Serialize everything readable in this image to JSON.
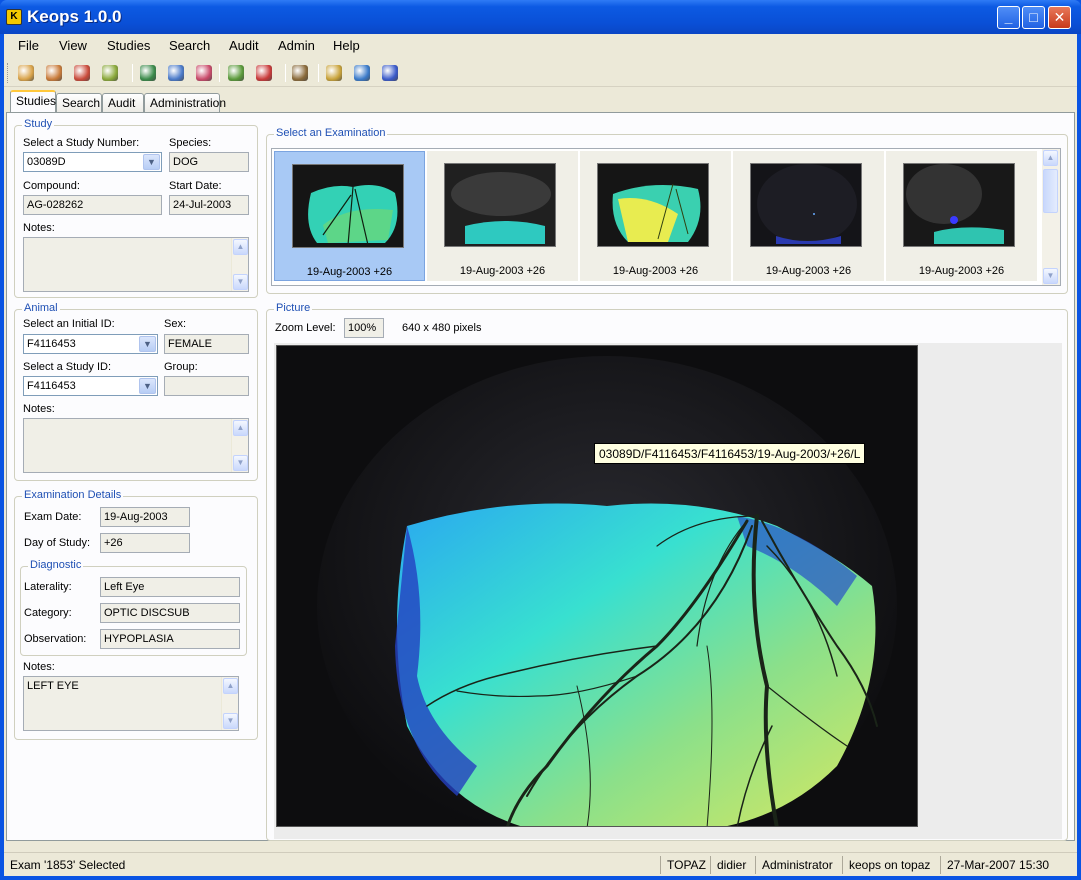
{
  "window": {
    "title": "Keops 1.0.0"
  },
  "menu": [
    "File",
    "View",
    "Studies",
    "Search",
    "Audit",
    "Admin",
    "Help"
  ],
  "toolbar": [
    {
      "icon": "new-study-icon",
      "color": "#d9a34a"
    },
    {
      "icon": "open-study-icon",
      "color": "#c97b3a"
    },
    {
      "icon": "delete-study-icon",
      "color": "#c94a3a"
    },
    {
      "icon": "edit-study-icon",
      "color": "#8aa83a"
    },
    {
      "icon": "add-animal-icon",
      "color": "#3a8a4a"
    },
    {
      "icon": "edit-animal-icon",
      "color": "#4a7ac9"
    },
    {
      "icon": "delete-animal-icon",
      "color": "#c94a6a"
    },
    {
      "icon": "add-exam-icon",
      "color": "#5a9a3a"
    },
    {
      "icon": "delete-exam-icon",
      "color": "#c93a3a"
    },
    {
      "icon": "network-icon",
      "color": "#8a6a3a"
    },
    {
      "icon": "grid-icon",
      "color": "#c9a33a"
    },
    {
      "icon": "zoom-icon",
      "color": "#3a7ac9"
    },
    {
      "icon": "export-icon",
      "color": "#3a5ac9"
    }
  ],
  "tabs": [
    "Studies",
    "Search",
    "Audit",
    "Administration"
  ],
  "study": {
    "legend": "Study",
    "study_number_label": "Select a Study Number:",
    "study_number": "03089D",
    "species_label": "Species:",
    "species": "DOG",
    "compound_label": "Compound:",
    "compound": "AG-028262",
    "start_date_label": "Start Date:",
    "start_date": "24-Jul-2003",
    "notes_label": "Notes:",
    "notes": ""
  },
  "animal": {
    "legend": "Animal",
    "initial_id_label": "Select an Initial ID:",
    "initial_id": "F4116453",
    "sex_label": "Sex:",
    "sex": "FEMALE",
    "study_id_label": "Select a Study ID:",
    "study_id": "F4116453",
    "group_label": "Group:",
    "group": "",
    "notes_label": "Notes:",
    "notes": ""
  },
  "exam": {
    "legend": "Examination Details",
    "exam_date_label": "Exam Date:",
    "exam_date": "19-Aug-2003",
    "day_label": "Day of Study:",
    "day": "+26",
    "diagnostic": {
      "legend": "Diagnostic",
      "laterality_label": "Laterality:",
      "laterality": "Left Eye",
      "category_label": "Category:",
      "category": "OPTIC DISCSUB",
      "observation_label": "Observation:",
      "observation": "HYPOPLASIA"
    },
    "notes_label": "Notes:",
    "notes": "LEFT EYE"
  },
  "examinations": {
    "legend": "Select an Examination",
    "items": [
      {
        "caption": "19-Aug-2003  +26",
        "selected": true
      },
      {
        "caption": "19-Aug-2003  +26",
        "selected": false
      },
      {
        "caption": "19-Aug-2003  +26",
        "selected": false
      },
      {
        "caption": "19-Aug-2003  +26",
        "selected": false
      },
      {
        "caption": "19-Aug-2003  +26",
        "selected": false
      }
    ]
  },
  "picture": {
    "legend": "Picture",
    "zoom_label": "Zoom Level:",
    "zoom": "100%",
    "size": "640 x 480 pixels",
    "tooltip": "03089D/F4116453/F4116453/19-Aug-2003/+26/L"
  },
  "status": {
    "message": "Exam '1853' Selected",
    "server": "TOPAZ",
    "user": "didier",
    "role": "Administrator",
    "db": "keops on topaz",
    "datetime": "27-Mar-2007 15:30"
  }
}
